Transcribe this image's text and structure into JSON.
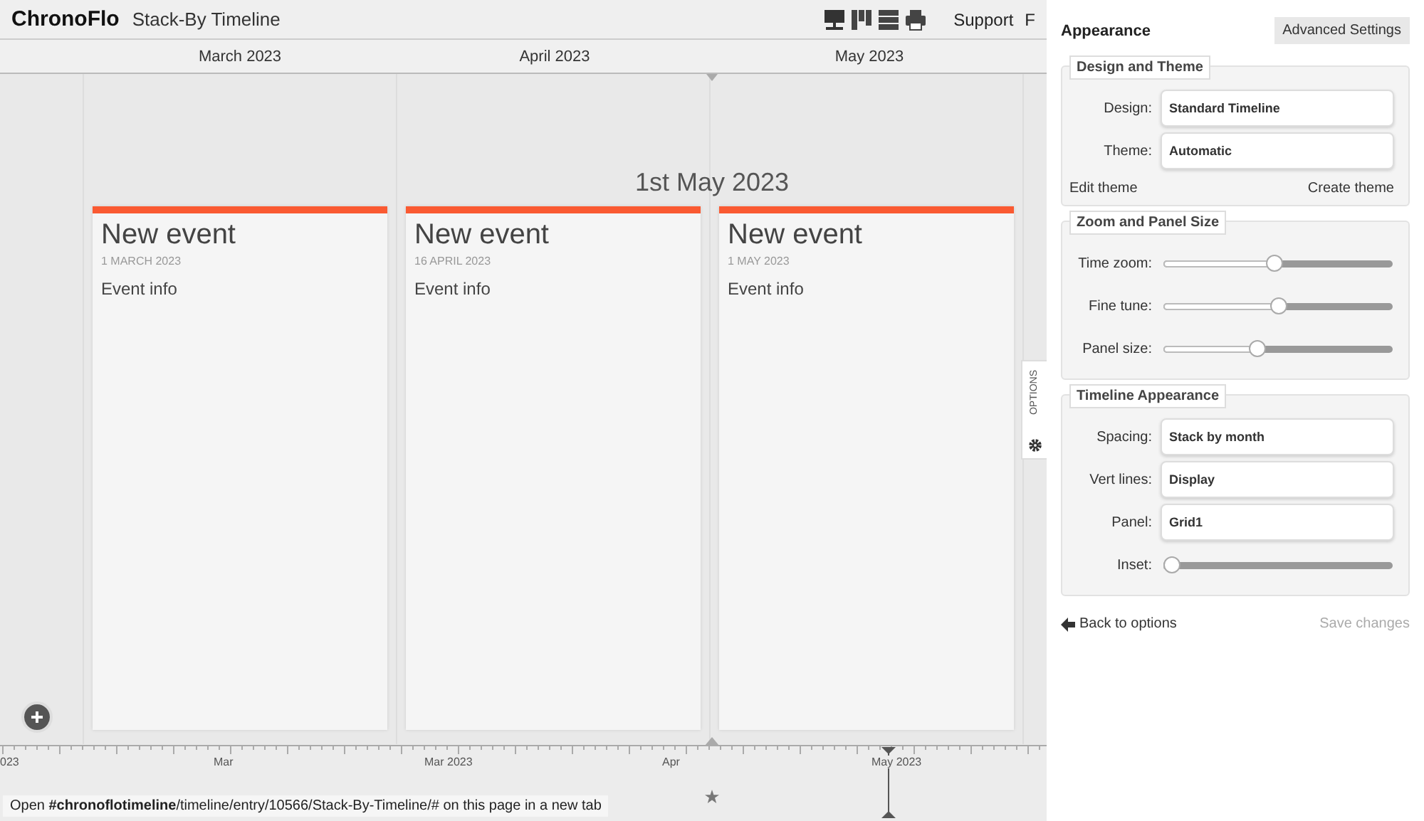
{
  "header": {
    "logo": "ChronoFlo",
    "title": "Stack-By Timeline",
    "nav": [
      "Support",
      "F"
    ]
  },
  "months": [
    "March 2023",
    "April 2023",
    "May 2023"
  ],
  "current_date": "1st May 2023",
  "events": [
    {
      "title": "New event",
      "date": "1 MARCH 2023",
      "info": "Event info",
      "color": "#fa5a32"
    },
    {
      "title": "New event",
      "date": "16 APRIL 2023",
      "info": "Event info",
      "color": "#fa5a32"
    },
    {
      "title": "New event",
      "date": "1 MAY 2023",
      "info": "Event info",
      "color": "#fa5a32"
    }
  ],
  "options_tab": "OPTIONS",
  "axis_labels": [
    "023",
    "Mar",
    "Mar 2023",
    "Apr",
    "May 2023"
  ],
  "status_link": "Open **#chronoflotimeline**/timeline/entry/10566/Stack-By-Timeline/# on this page in a new tab",
  "panel": {
    "title": "Appearance",
    "advanced_button": "Advanced Settings",
    "sections": [
      {
        "legend": "Design and Theme",
        "rows": [
          {
            "kind": "select",
            "label": "Design:",
            "value": "Standard Timeline"
          },
          {
            "kind": "select",
            "label": "Theme:",
            "value": "Automatic"
          }
        ],
        "links": [
          "Edit theme",
          "Create theme"
        ]
      },
      {
        "legend": "Zoom and Panel Size",
        "rows": [
          {
            "kind": "slider",
            "label": "Time zoom:",
            "level": 0.48
          },
          {
            "kind": "slider",
            "label": "Fine tune:",
            "level": 0.5
          },
          {
            "kind": "slider",
            "label": "Panel size:",
            "level": 0.4
          }
        ]
      },
      {
        "legend": "Timeline Appearance",
        "rows": [
          {
            "kind": "select",
            "label": "Spacing:",
            "value": "Stack by month"
          },
          {
            "kind": "select",
            "label": "Vert lines:",
            "value": "Display"
          },
          {
            "kind": "select",
            "label": "Panel:",
            "value": "Grid1"
          },
          {
            "kind": "slider",
            "label": "Inset:",
            "level": 0
          }
        ]
      }
    ],
    "back_link": "Back to options",
    "save_button": "Save changes"
  }
}
